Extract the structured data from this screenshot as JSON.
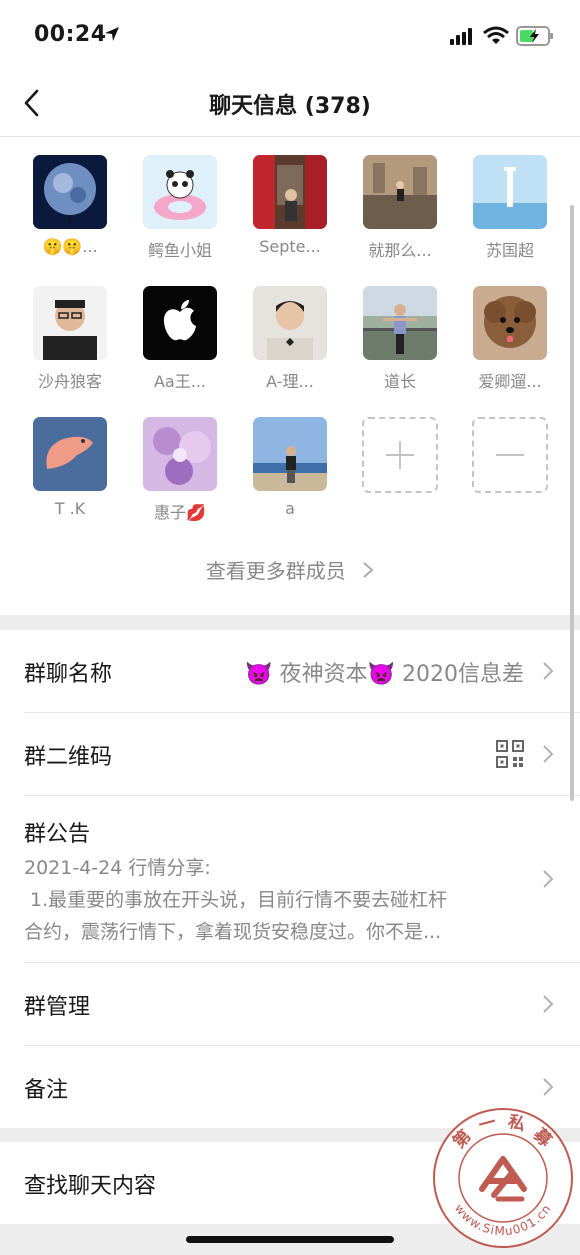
{
  "status": {
    "time": "00:24"
  },
  "nav": {
    "title": "聊天信息 (378)",
    "back_icon": "chevron-left-icon"
  },
  "members": [
    {
      "name": "🤫🤫..."
    },
    {
      "name": "鳄鱼小姐"
    },
    {
      "name": "Septe..."
    },
    {
      "name": "就那么..."
    },
    {
      "name": "苏国超"
    },
    {
      "name": "沙舟狼客"
    },
    {
      "name": "Aa王..."
    },
    {
      "name": "A-理..."
    },
    {
      "name": "道长"
    },
    {
      "name": "爱卿遛..."
    },
    {
      "name": "T .K"
    },
    {
      "name": "惠子💋"
    },
    {
      "name": "a"
    }
  ],
  "add_button_icon": "plus-icon",
  "remove_button_icon": "minus-icon",
  "more_members": "查看更多群成员",
  "settings": {
    "group_name_label": "群聊名称",
    "group_name_value": "👿 夜神资本👿 2020信息差",
    "qrcode_label": "群二维码",
    "announcement_label": "群公告",
    "announcement_text": "2021-4-24 行情分享:\n 1.最重要的事放在开头说，目前行情不要去碰杠杆合约，震荡行情下，拿着现货安稳度过。你不是...",
    "manage_label": "群管理",
    "remark_label": "备注",
    "search_label": "查找聊天内容"
  },
  "watermark": {
    "top_text": "第 一 私 募",
    "bottom_text": "www.SiMu001.cn"
  }
}
